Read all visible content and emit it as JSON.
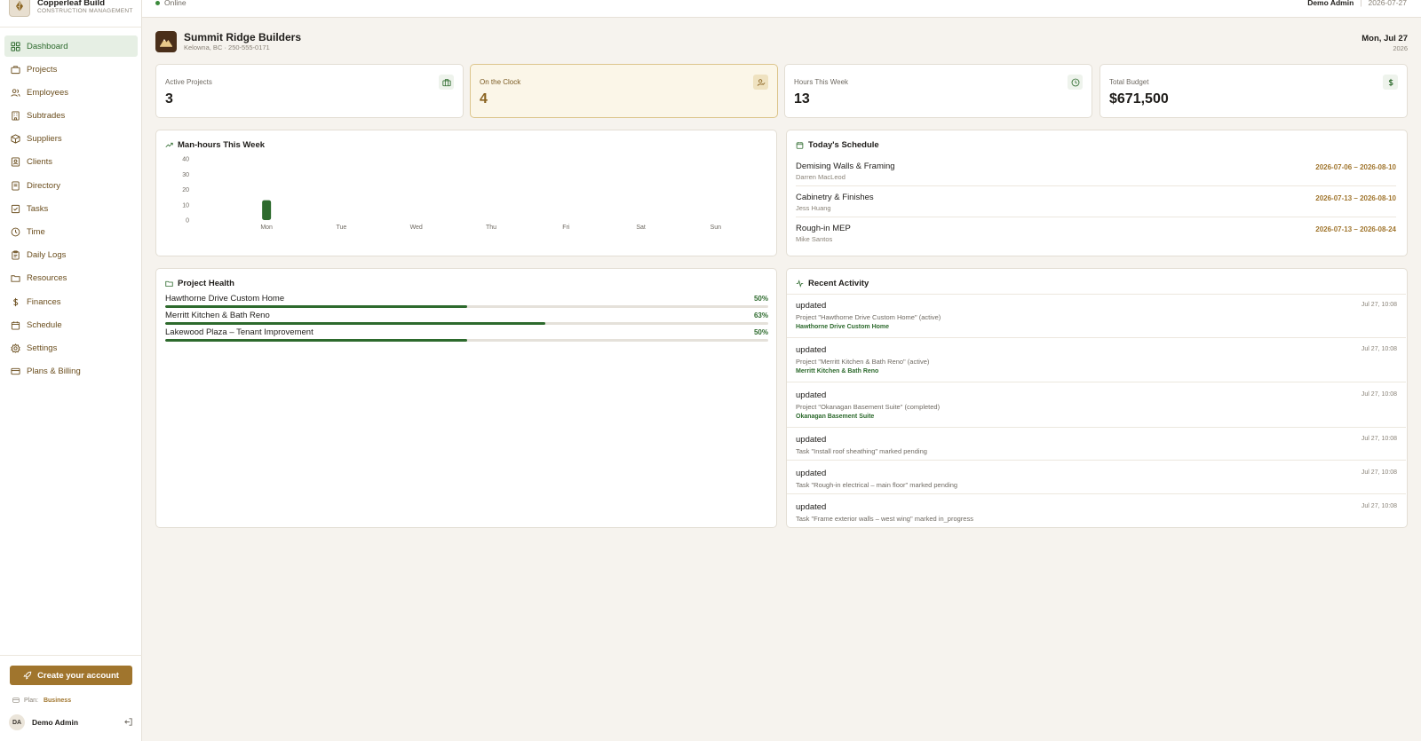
{
  "brand": {
    "name": "Copperleaf Build",
    "subtitle": "CONSTRUCTION MANAGEMENT"
  },
  "nav": [
    {
      "label": "Dashboard",
      "icon": "dashboard-icon",
      "active": true
    },
    {
      "label": "Projects",
      "icon": "briefcase-icon"
    },
    {
      "label": "Employees",
      "icon": "users-icon"
    },
    {
      "label": "Subtrades",
      "icon": "building-icon"
    },
    {
      "label": "Suppliers",
      "icon": "package-icon"
    },
    {
      "label": "Clients",
      "icon": "contact-icon"
    },
    {
      "label": "Directory",
      "icon": "book-icon"
    },
    {
      "label": "Tasks",
      "icon": "checkbox-icon"
    },
    {
      "label": "Time",
      "icon": "clock-icon"
    },
    {
      "label": "Daily Logs",
      "icon": "clipboard-icon"
    },
    {
      "label": "Resources",
      "icon": "folder-icon"
    },
    {
      "label": "Finances",
      "icon": "dollar-icon"
    },
    {
      "label": "Schedule",
      "icon": "calendar-icon"
    },
    {
      "label": "Settings",
      "icon": "gear-icon"
    },
    {
      "label": "Plans & Billing",
      "icon": "credit-card-icon"
    }
  ],
  "sidebar_footer": {
    "create_label": "Create your account",
    "plan_label": "Plan:",
    "plan_value": "Business",
    "user_initials": "DA",
    "user_name": "Demo Admin"
  },
  "topbar": {
    "status": "Online",
    "user": "Demo Admin",
    "date": "2026-07-27"
  },
  "company": {
    "name": "Summit Ridge Builders",
    "meta": "Kelowna, BC · 250-555-0171"
  },
  "today": {
    "date": "Mon, Jul 27",
    "year": "2026"
  },
  "stats": [
    {
      "label": "Active Projects",
      "value": "3",
      "icon": "briefcase-icon"
    },
    {
      "label": "On the Clock",
      "value": "4",
      "icon": "user-check-icon"
    },
    {
      "label": "Hours This Week",
      "value": "13",
      "icon": "clock-icon"
    },
    {
      "label": "Total Budget",
      "value": "$671,500",
      "icon": "dollar-icon"
    }
  ],
  "manhours": {
    "title": "Man-hours This Week"
  },
  "chart_data": {
    "type": "bar",
    "title": "Man-hours This Week",
    "categories": [
      "Mon",
      "Tue",
      "Wed",
      "Thu",
      "Fri",
      "Sat",
      "Sun"
    ],
    "values": [
      13,
      0,
      0,
      0,
      0,
      0,
      0
    ],
    "yticks": [
      0,
      10,
      20,
      30,
      40
    ],
    "ylim": [
      0,
      40
    ],
    "grid": false,
    "color": "#2d6a2d"
  },
  "schedule": {
    "title": "Today's Schedule",
    "items": [
      {
        "name": "Demising Walls & Framing",
        "person": "Darren MacLeod",
        "dates": "2026-07-06 – 2026-08-10"
      },
      {
        "name": "Cabinetry & Finishes",
        "person": "Jess Huang",
        "dates": "2026-07-13 – 2026-08-10"
      },
      {
        "name": "Rough-in MEP",
        "person": "Mike Santos",
        "dates": "2026-07-13 – 2026-08-24"
      }
    ]
  },
  "health": {
    "title": "Project Health",
    "projects": [
      {
        "name": "Hawthorne Drive Custom Home",
        "pct_label": "50%",
        "pct": 50
      },
      {
        "name": "Merritt Kitchen & Bath Reno",
        "pct_label": "63%",
        "pct": 63
      },
      {
        "name": "Lakewood Plaza – Tenant Improvement",
        "pct_label": "50%",
        "pct": 50
      }
    ]
  },
  "activity": {
    "title": "Recent Activity",
    "items": [
      {
        "action": "updated",
        "desc": "Project \"Hawthorne Drive Custom Home\" (active)",
        "link": "Hawthorne Drive Custom Home",
        "time": "Jul 27, 10:08"
      },
      {
        "action": "updated",
        "desc": "Project \"Merritt Kitchen & Bath Reno\" (active)",
        "link": "Merritt Kitchen & Bath Reno",
        "time": "Jul 27, 10:08"
      },
      {
        "action": "updated",
        "desc": "Project \"Okanagan Basement Suite\" (completed)",
        "link": "Okanagan Basement Suite",
        "time": "Jul 27, 10:08"
      },
      {
        "action": "updated",
        "desc": "Task \"Install roof sheathing\" marked pending",
        "link": "",
        "time": "Jul 27, 10:08"
      },
      {
        "action": "updated",
        "desc": "Task \"Rough-in electrical – main floor\" marked pending",
        "link": "",
        "time": "Jul 27, 10:08"
      },
      {
        "action": "updated",
        "desc": "Task \"Frame exterior walls – west wing\" marked in_progress",
        "link": "",
        "time": "Jul 27, 10:08"
      }
    ]
  },
  "colors": {
    "accent": "#2d6a2d",
    "brand": "#a0752d",
    "highlight_bg": "#fbf6e8"
  }
}
